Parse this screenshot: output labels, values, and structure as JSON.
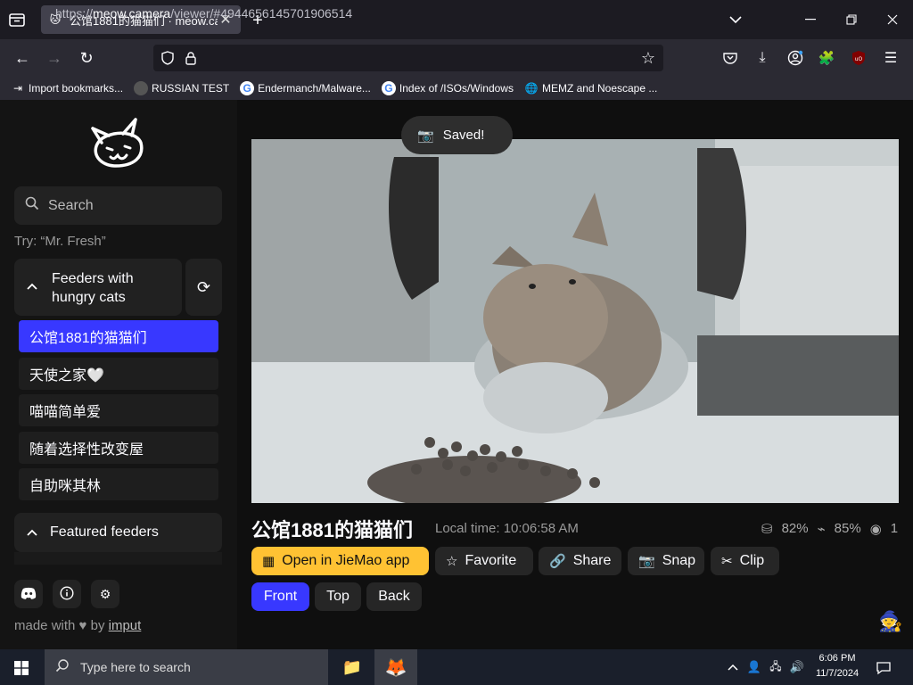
{
  "browser": {
    "tab_title": "公馆1881的猫猫们 · meow.cam",
    "url_prefix": "https://",
    "url_domain": "meow.camera",
    "url_path": "/viewer/#4944656145701906514",
    "bookmarks": [
      {
        "label": "Import bookmarks...",
        "icon": "import-icon"
      },
      {
        "label": "RUSSIAN TEST",
        "icon": "site-icon"
      },
      {
        "label": "Endermanch/Malware...",
        "icon": "google-icon"
      },
      {
        "label": "Index of /ISOs/Windows",
        "icon": "google-icon"
      },
      {
        "label": "MEMZ and Noescape ...",
        "icon": "globe-icon"
      }
    ]
  },
  "sidebar": {
    "search_placeholder": "Search",
    "try_hint": "Try: “Mr. Fresh”",
    "group1_label": "Feeders with hungry cats",
    "feeders": [
      {
        "label": "公馆1881的猫猫们",
        "active": true
      },
      {
        "label": "天使之家🤍",
        "active": false
      },
      {
        "label": "喵喵简单爱",
        "active": false
      },
      {
        "label": "随着选择性改变屋",
        "active": false
      },
      {
        "label": "自助咪其林",
        "active": false
      }
    ],
    "group2_label": "Featured feeders",
    "made_with_prefix": "made with",
    "made_with_by": "by",
    "made_with_author": "imput"
  },
  "viewer": {
    "toast": "Saved!",
    "cam_title": "公馆1881的猫猫们",
    "local_time": "Local time: 10:06:58 AM",
    "stat_food": "82%",
    "stat_battery": "85%",
    "stat_viewers": "1",
    "actions": {
      "open_app": "Open in JieMao app",
      "favorite": "Favorite",
      "share": "Share",
      "snap": "Snap",
      "clip": "Clip"
    },
    "views": {
      "front": "Front",
      "top": "Top",
      "back": "Back"
    }
  },
  "taskbar": {
    "search_placeholder": "Type here to search",
    "time": "6:06 PM",
    "date": "11/7/2024"
  }
}
